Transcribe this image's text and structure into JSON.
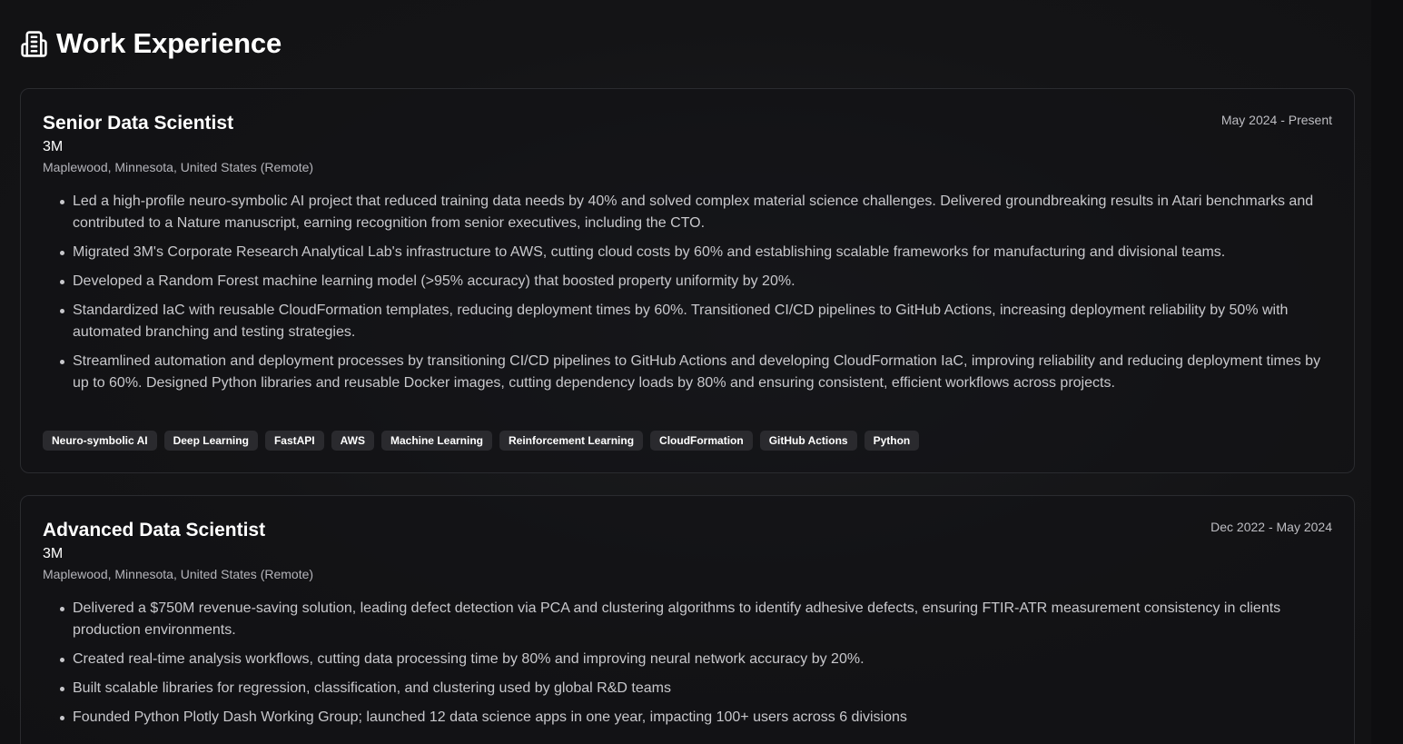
{
  "section": {
    "title": "Work Experience",
    "icon": "building-icon"
  },
  "jobs": [
    {
      "title": "Senior Data Scientist",
      "date": "May 2024 - Present",
      "company": "3M",
      "location": "Maplewood, Minnesota, United States (Remote)",
      "bullets": [
        "Led a high-profile neuro-symbolic AI project that reduced training data needs by 40% and solved complex material science challenges. Delivered groundbreaking results in Atari benchmarks and contributed to a Nature manuscript, earning recognition from senior executives, including the CTO.",
        "Migrated 3M's Corporate Research Analytical Lab's infrastructure to AWS, cutting cloud costs by 60% and establishing scalable frameworks for manufacturing and divisional teams.",
        "Developed a Random Forest machine learning model (>95% accuracy) that boosted property uniformity by 20%.",
        "Standardized IaC with reusable CloudFormation templates, reducing deployment times by 60%. Transitioned CI/CD pipelines to GitHub Actions, increasing deployment reliability by 50% with automated branching and testing strategies.",
        "Streamlined automation and deployment processes by transitioning CI/CD pipelines to GitHub Actions and developing CloudFormation IaC, improving reliability and reducing deployment times by up to 60%. Designed Python libraries and reusable Docker images, cutting dependency loads by 80% and ensuring consistent, efficient workflows across projects."
      ],
      "tags": [
        "Neuro-symbolic AI",
        "Deep Learning",
        "FastAPI",
        "AWS",
        "Machine Learning",
        "Reinforcement Learning",
        "CloudFormation",
        "GitHub Actions",
        "Python"
      ]
    },
    {
      "title": "Advanced Data Scientist",
      "date": "Dec 2022 - May 2024",
      "company": "3M",
      "location": "Maplewood, Minnesota, United States (Remote)",
      "bullets": [
        "Delivered a $750M revenue-saving solution, leading defect detection via PCA and clustering algorithms to identify adhesive defects, ensuring FTIR-ATR measurement consistency in clients production environments.",
        "Created real-time analysis workflows, cutting data processing time by 80% and improving neural network accuracy by 20%.",
        "Built scalable libraries for regression, classification, and clustering used by global R&D teams",
        "Founded Python Plotly Dash Working Group; launched 12 data science apps in one year, impacting 100+ users across 6 divisions"
      ],
      "tags": []
    }
  ]
}
